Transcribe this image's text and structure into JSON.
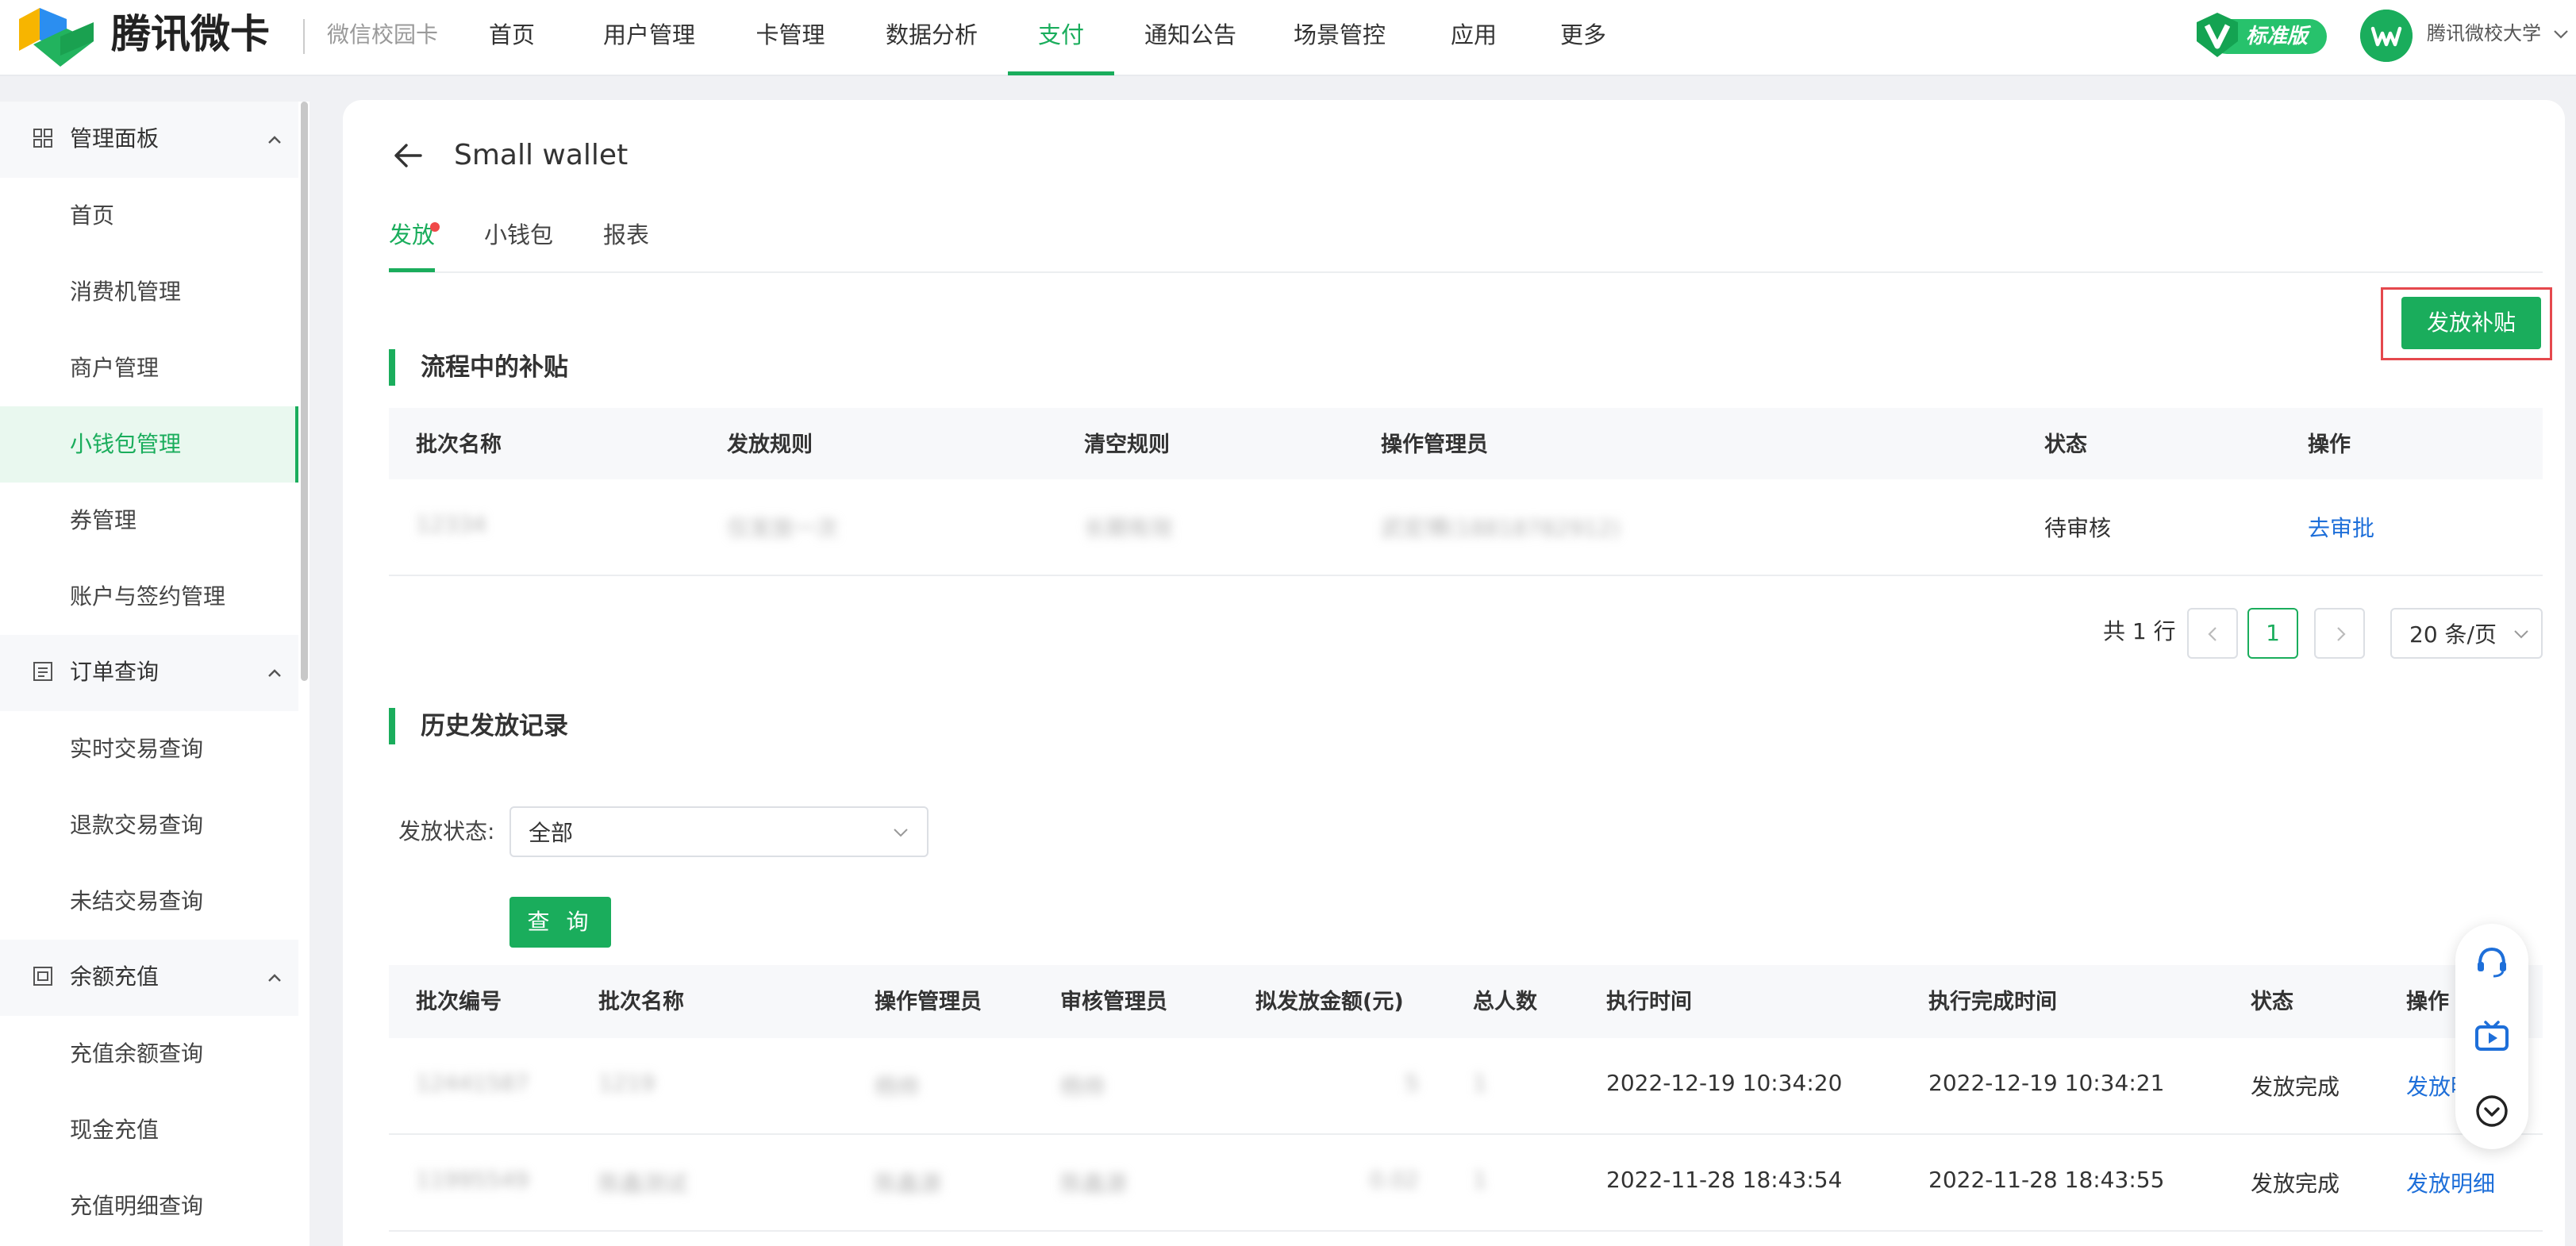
{
  "brand": {
    "name": "腾讯微卡",
    "product": "微信校园卡"
  },
  "nav": {
    "items": [
      "首页",
      "用户管理",
      "卡管理",
      "数据分析",
      "支付",
      "通知公告",
      "场景管控",
      "应用",
      "更多"
    ],
    "active": "支付"
  },
  "plan_badge": "标准版",
  "account": {
    "name": "腾讯微校大学"
  },
  "sidebar": {
    "group1": {
      "label": "管理面板",
      "items": [
        "首页",
        "消费机管理",
        "商户管理",
        "小钱包管理",
        "券管理",
        "账户与签约管理"
      ]
    },
    "group2": {
      "label": "订单查询",
      "items": [
        "实时交易查询",
        "退款交易查询",
        "未结交易查询"
      ]
    },
    "group3": {
      "label": "余额充值",
      "items": [
        "充值余额查询",
        "现金充值",
        "充值明细查询"
      ]
    },
    "active_item": "小钱包管理"
  },
  "page": {
    "title": "Small wallet",
    "tabs": [
      "发放",
      "小钱包",
      "报表"
    ],
    "active_tab": "发放",
    "issue_button": "发放补贴"
  },
  "in_progress": {
    "title": "流程中的补贴",
    "columns": [
      "批次名称",
      "发放规则",
      "清空规则",
      "操作管理员",
      "状态",
      "操作"
    ],
    "rows": [
      {
        "batch_name": "12334",
        "issue_rule": "仅发放一次",
        "clear_rule": "长期有效",
        "operator": "武宏博(18818782912)",
        "status": "待审核",
        "action": "去审批"
      }
    ]
  },
  "pagination": {
    "total": "共 1 行",
    "current_page": "1",
    "page_size": "20 条/页"
  },
  "history": {
    "title": "历史发放记录",
    "filter_label": "发放状态:",
    "filter_value": "全部",
    "query_button": "查 询",
    "columns": [
      "批次编号",
      "批次名称",
      "操作管理员",
      "审核管理员",
      "拟发放金额(元)",
      "总人数",
      "执行时间",
      "执行完成时间",
      "状态",
      "操作"
    ],
    "rows": [
      {
        "batch_no": "12441587",
        "batch_name": "1219",
        "operator": "杨帅",
        "reviewer": "杨帅",
        "amount": "5",
        "people": "1",
        "exec_time": "2022-12-19 10:34:20",
        "done_time": "2022-12-19 10:34:21",
        "status": "发放完成",
        "action": "发放明细"
      },
      {
        "batch_no": "11995549",
        "batch_name": "陈鑫测试",
        "operator": "陈鑫源",
        "reviewer": "陈鑫源",
        "amount": "0.02",
        "people": "1",
        "exec_time": "2022-11-28 18:43:54",
        "done_time": "2022-11-28 18:43:55",
        "status": "发放完成",
        "action": "发放明细"
      }
    ]
  },
  "colors": {
    "accent": "#1aad5c",
    "link": "#1e6fd9",
    "highlight_frame": "#e5484d",
    "dot": "#f04848"
  }
}
